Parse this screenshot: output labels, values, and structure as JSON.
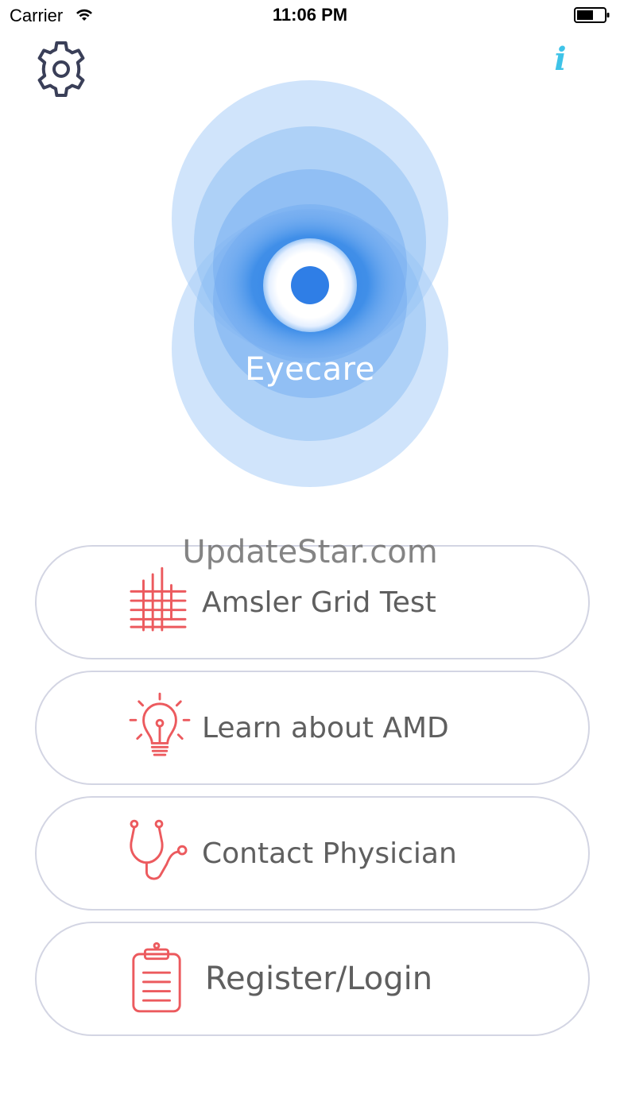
{
  "status_bar": {
    "carrier": "Carrier",
    "time": "11:06 PM"
  },
  "header": {
    "settings_icon": "gear-icon",
    "info_label": "i"
  },
  "logo": {
    "title": "Eyecare",
    "colors": {
      "light": "#cde3fb",
      "mid": "#a9cdf7",
      "dark": "#3d8de8",
      "center": "#2f7ee6"
    }
  },
  "watermark": "UpdateStar.com",
  "menu": [
    {
      "label": "Amsler Grid Test",
      "icon": "grid-icon"
    },
    {
      "label": "Learn about AMD",
      "icon": "lightbulb-icon"
    },
    {
      "label": "Contact Physician",
      "icon": "stethoscope-icon"
    },
    {
      "label": "Register/Login",
      "icon": "clipboard-icon"
    }
  ],
  "colors": {
    "accent_red": "#ec5a5e",
    "button_border": "#d3d5e3",
    "label_gray": "#5f5f5f",
    "info_blue": "#3ec3e8"
  }
}
